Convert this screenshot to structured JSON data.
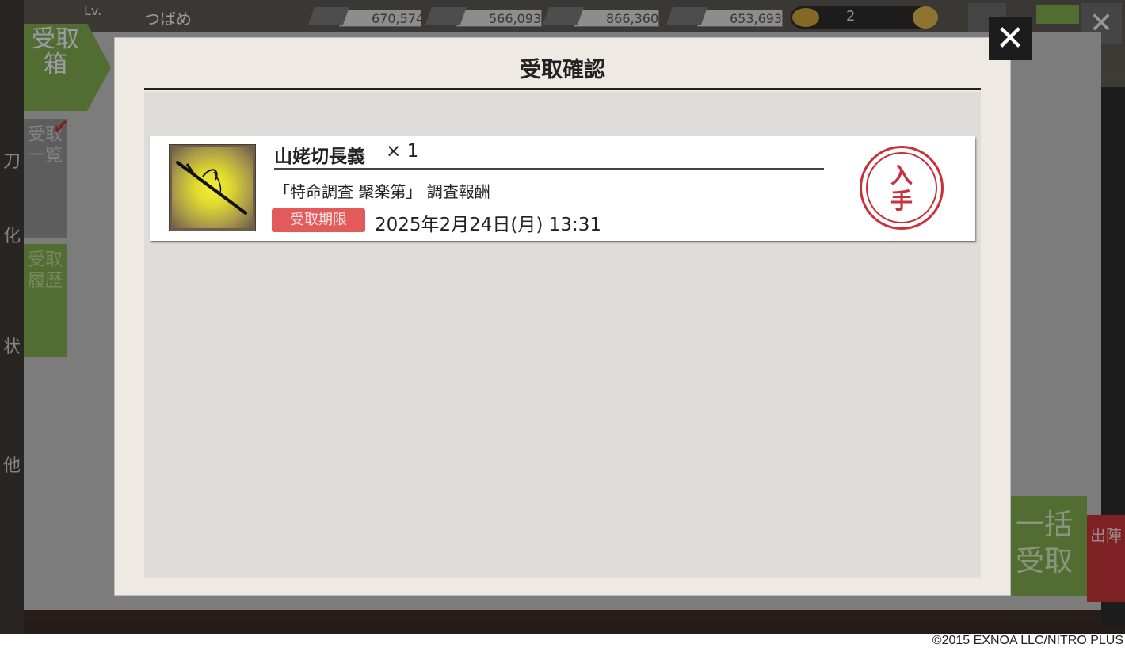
{
  "background": {
    "level_label": "Lv.",
    "player_name": "つばめ",
    "resources": [
      "670,574",
      "566,093",
      "866,360",
      "653,693"
    ],
    "coin_value": "2",
    "inbox_label": "受取箱",
    "tab_list": "受取一覧",
    "tab_history": "受取履歴",
    "bulk_receive": "一括受取",
    "sortie": "出陣"
  },
  "modal": {
    "title": "受取確認",
    "close_icon": "close-x-icon"
  },
  "items": [
    {
      "name": "山姥切長義",
      "quantity": "× 1",
      "source": "「特命調査 聚楽第」 調査報酬",
      "deadline_label": "受取期限",
      "deadline": "2025年2月24日(月) 13:31",
      "stamp_top": "入",
      "stamp_bottom": "手",
      "thumbnail_icon": "sword-icon"
    }
  ],
  "copyright": "©2015 EXNOA LLC/NITRO PLUS"
}
